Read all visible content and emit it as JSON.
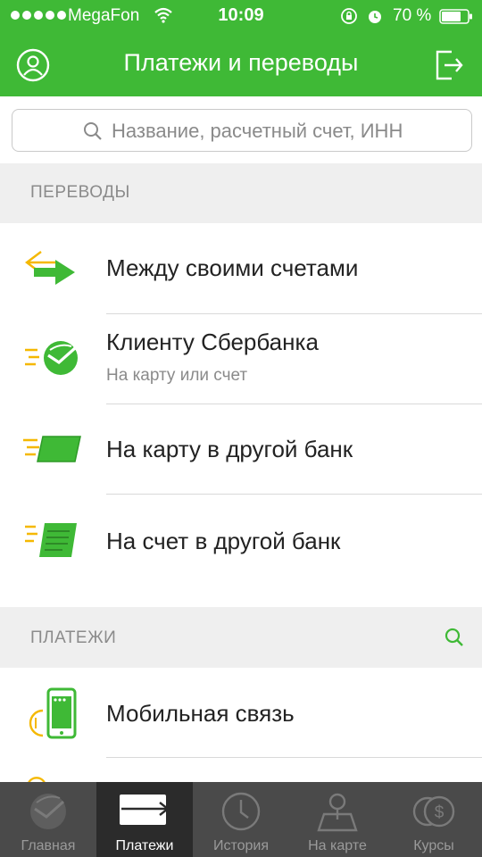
{
  "status_bar": {
    "carrier": "MegaFon",
    "time": "10:09",
    "battery": "70 %"
  },
  "header": {
    "title": "Платежи и переводы"
  },
  "search": {
    "placeholder": "Название, расчетный счет, ИНН"
  },
  "transfers": {
    "header": "ПЕРЕВОДЫ",
    "items": [
      {
        "title": "Между своими счетами",
        "icon": "transfer-arrows-icon"
      },
      {
        "title": "Клиенту Сбербанка",
        "subtitle": "На карту или счет",
        "icon": "sberbank-logo-icon"
      },
      {
        "title": "На карту в другой банк",
        "icon": "card-icon"
      },
      {
        "title": "На счет в другой банк",
        "icon": "document-icon"
      }
    ]
  },
  "payments": {
    "header": "ПЛАТЕЖИ",
    "items": [
      {
        "title": "Мобильная связь",
        "icon": "mobile-phone-icon"
      }
    ]
  },
  "tabbar": {
    "tabs": [
      {
        "label": "Главная",
        "icon": "sberbank-logo-icon",
        "active": false
      },
      {
        "label": "Платежи",
        "icon": "payment-arrow-icon",
        "active": true
      },
      {
        "label": "История",
        "icon": "clock-icon",
        "active": false
      },
      {
        "label": "На карте",
        "icon": "map-person-icon",
        "active": false
      },
      {
        "label": "Курсы",
        "icon": "currency-coins-icon",
        "active": false
      }
    ]
  },
  "colors": {
    "brand_green": "#3fb936",
    "accent_yellow": "#f5b800",
    "tabbar_bg": "#4a4a4a"
  }
}
